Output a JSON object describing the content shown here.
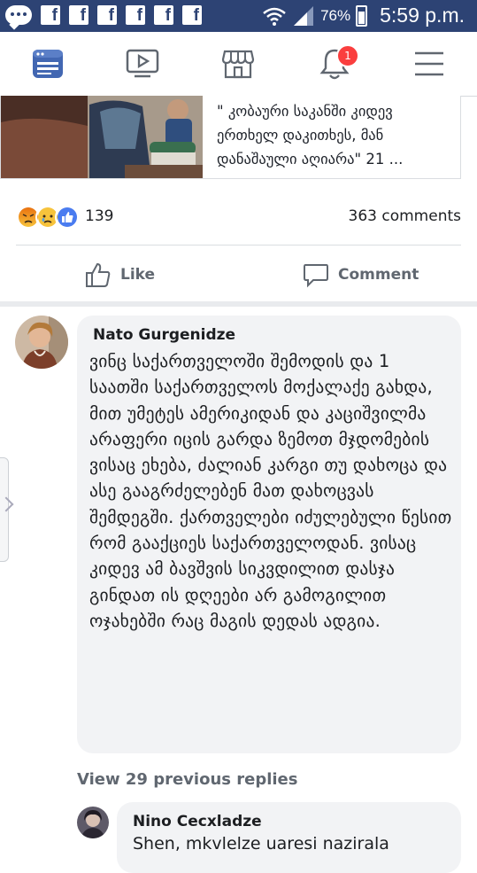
{
  "status_bar": {
    "battery": "76%",
    "time": "5:59 p.m.",
    "notification_icons": [
      "messenger-icon",
      "facebook-icon",
      "facebook-icon",
      "facebook-icon",
      "facebook-icon",
      "facebook-icon",
      "facebook-icon"
    ]
  },
  "nav": {
    "items": [
      "news-feed-icon",
      "watch-icon",
      "marketplace-icon",
      "notifications-icon",
      "menu-icon"
    ],
    "notifications_badge": "1",
    "active_color": "#4267b2"
  },
  "post": {
    "link_title": "\" კობაური საკანში კიდევ ერთხელ დაკითხეს, მან დანაშაული აღიარა\" 21 ...",
    "reaction_count": "139",
    "comments_count": "363 comments",
    "actions": {
      "like": "Like",
      "comment": "Comment"
    }
  },
  "comments": [
    {
      "author": "Nato Gurgenidze",
      "text": "ვინც საქართველოში შემოდის და 1 საათში საქართველოს მოქალაქე გახდა, მით უმეტეს ამერიკიდან და კაციშვილმა არაფერი იცის გარდა ზემოთ მჯდომების ვისაც ეხება, ძალიან კარგი თუ დახოცა და ასე გააგრძელებენ მათ დახოცვას შემდეგში. ქართველები იძულებული წესით რომ გააქციეს საქართველოდან. ვისაც კიდევ ამ ბავშვის სიკვდილით დასჯა გინდათ ის დღეები არ გამოგილით ოჯახებში რაც მაგის დედას ადგია."
    }
  ],
  "view_replies": "View 29 previous replies",
  "replies": [
    {
      "author": "Nino Cecxladze",
      "text": "Shen, mkvlelze uaresi nazirala"
    }
  ]
}
